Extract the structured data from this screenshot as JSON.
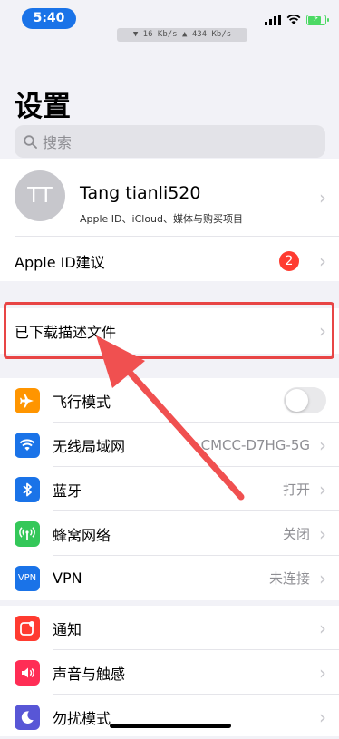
{
  "status": {
    "time": "5:40",
    "speed": "▼ 16 Kb/s   ▲ 434 Kb/s"
  },
  "page": {
    "title": "设置"
  },
  "search": {
    "placeholder": "搜索"
  },
  "profile": {
    "initials": "TT",
    "name": "Tang tianli520",
    "subtitle": "Apple ID、iCloud、媒体与购买项目"
  },
  "suggestion": {
    "label": "Apple ID建议",
    "badge": "2"
  },
  "downloaded": {
    "label": "已下载描述文件"
  },
  "connectivity": [
    {
      "label": "飞行模式",
      "value": "",
      "icon": "airplane-icon",
      "color": "#ff9500",
      "toggle": true
    },
    {
      "label": "无线局域网",
      "value": "CMCC-D7HG-5G",
      "icon": "wifi-icon",
      "color": "#1a73e8"
    },
    {
      "label": "蓝牙",
      "value": "打开",
      "icon": "bluetooth-icon",
      "color": "#1a73e8"
    },
    {
      "label": "蜂窝网络",
      "value": "关闭",
      "icon": "cellular-icon",
      "color": "#34c759"
    },
    {
      "label": "VPN",
      "value": "未连接",
      "icon": "vpn-icon",
      "color": "#1a73e8",
      "icon_text": "VPN"
    }
  ],
  "notifications": [
    {
      "label": "通知",
      "icon": "notification-icon",
      "color": "#ff3b30"
    },
    {
      "label": "声音与触感",
      "icon": "sound-icon",
      "color": "#ff2d55"
    },
    {
      "label": "勿扰模式",
      "icon": "moon-icon",
      "color": "#5856d6"
    }
  ],
  "colors": {
    "highlight": "#e84545",
    "arrow": "#f05050"
  }
}
